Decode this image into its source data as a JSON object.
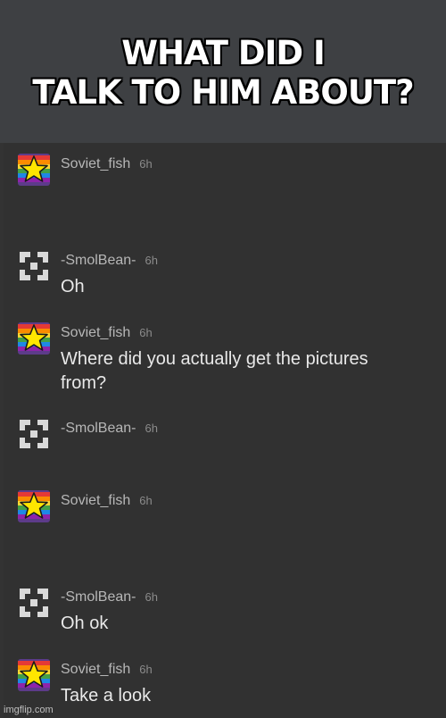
{
  "caption": {
    "line1": "WHAT DID I",
    "line2": "TALK TO HIM ABOUT?"
  },
  "messages": [
    {
      "user": "Soviet_fish",
      "time": "6h",
      "text": "",
      "avatar": "rainbow-star-avatar"
    },
    {
      "user": "-SmolBean-",
      "time": "6h",
      "text": "Oh",
      "avatar": "pixel-frame-avatar"
    },
    {
      "user": "Soviet_fish",
      "time": "6h",
      "text": "Where did you actually get the pictures from?",
      "avatar": "rainbow-star-avatar"
    },
    {
      "user": "-SmolBean-",
      "time": "6h",
      "text": "",
      "avatar": "pixel-frame-avatar"
    },
    {
      "user": "Soviet_fish",
      "time": "6h",
      "text": "",
      "avatar": "rainbow-star-avatar"
    },
    {
      "user": "-SmolBean-",
      "time": "6h",
      "text": "Oh ok",
      "avatar": "pixel-frame-avatar"
    },
    {
      "user": "Soviet_fish",
      "time": "6h",
      "text": "Take a look",
      "avatar": "rainbow-star-avatar"
    }
  ],
  "watermark": "imgflip.com",
  "colors": {
    "banner_bg": "#3e4043",
    "chat_bg": "#313131",
    "username": "#b7b7b7",
    "message_text": "#e9e9e9",
    "star": "#ffe600",
    "rainbow": [
      "#e53935",
      "#fb8c00",
      "#fdd835",
      "#43a047",
      "#1e88e5",
      "#8e24aa"
    ]
  }
}
